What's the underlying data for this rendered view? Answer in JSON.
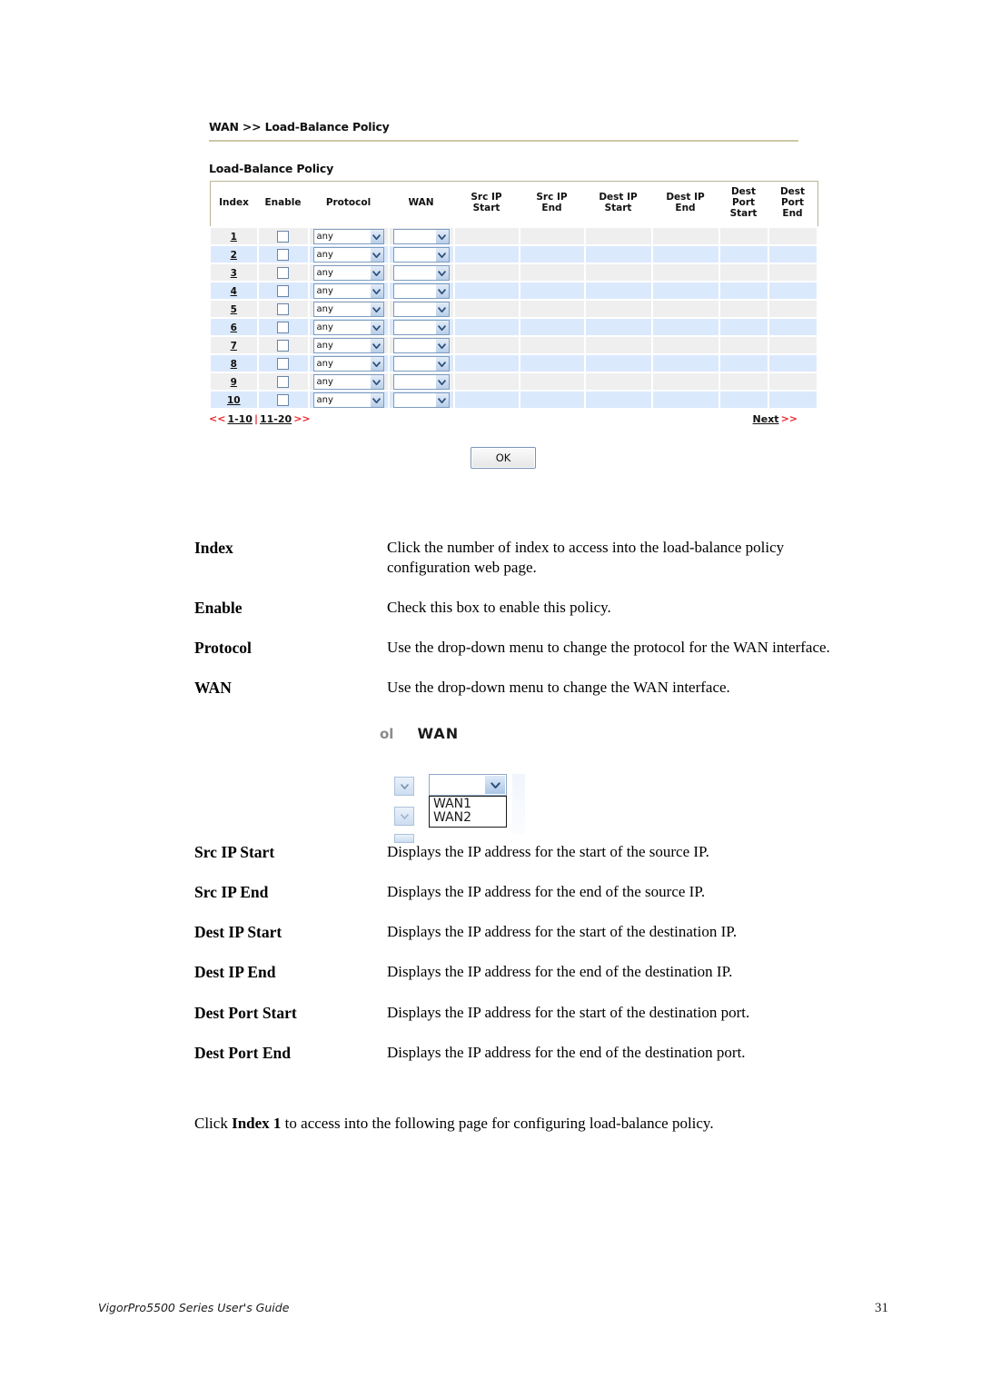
{
  "router_ui": {
    "breadcrumb": "WAN >> Load-Balance Policy",
    "section_title": "Load-Balance Policy",
    "columns": [
      "Index",
      "Enable",
      "Protocol",
      "WAN",
      "Src IP\nStart",
      "Src IP\nEnd",
      "Dest IP\nStart",
      "Dest IP\nEnd",
      "Dest\nPort\nStart",
      "Dest\nPort\nEnd"
    ],
    "column_labels": {
      "index": "Index",
      "enable": "Enable",
      "protocol": "Protocol",
      "wan": "WAN",
      "src_ip_start_l1": "Src IP",
      "src_ip_start_l2": "Start",
      "src_ip_end_l1": "Src IP",
      "src_ip_end_l2": "End",
      "dest_ip_start_l1": "Dest IP",
      "dest_ip_start_l2": "Start",
      "dest_ip_end_l1": "Dest IP",
      "dest_ip_end_l2": "End",
      "dest_port_start_l1": "Dest",
      "dest_port_start_l2": "Port",
      "dest_port_start_l3": "Start",
      "dest_port_end_l1": "Dest",
      "dest_port_end_l2": "Port",
      "dest_port_end_l3": "End"
    },
    "rows": [
      {
        "index": "1",
        "enable": false,
        "protocol": "any",
        "wan": "",
        "src_ip_start": "",
        "src_ip_end": "",
        "dest_ip_start": "",
        "dest_ip_end": "",
        "dest_port_start": "",
        "dest_port_end": ""
      },
      {
        "index": "2",
        "enable": false,
        "protocol": "any",
        "wan": "",
        "src_ip_start": "",
        "src_ip_end": "",
        "dest_ip_start": "",
        "dest_ip_end": "",
        "dest_port_start": "",
        "dest_port_end": ""
      },
      {
        "index": "3",
        "enable": false,
        "protocol": "any",
        "wan": "",
        "src_ip_start": "",
        "src_ip_end": "",
        "dest_ip_start": "",
        "dest_ip_end": "",
        "dest_port_start": "",
        "dest_port_end": ""
      },
      {
        "index": "4",
        "enable": false,
        "protocol": "any",
        "wan": "",
        "src_ip_start": "",
        "src_ip_end": "",
        "dest_ip_start": "",
        "dest_ip_end": "",
        "dest_port_start": "",
        "dest_port_end": ""
      },
      {
        "index": "5",
        "enable": false,
        "protocol": "any",
        "wan": "",
        "src_ip_start": "",
        "src_ip_end": "",
        "dest_ip_start": "",
        "dest_ip_end": "",
        "dest_port_start": "",
        "dest_port_end": ""
      },
      {
        "index": "6",
        "enable": false,
        "protocol": "any",
        "wan": "",
        "src_ip_start": "",
        "src_ip_end": "",
        "dest_ip_start": "",
        "dest_ip_end": "",
        "dest_port_start": "",
        "dest_port_end": ""
      },
      {
        "index": "7",
        "enable": false,
        "protocol": "any",
        "wan": "",
        "src_ip_start": "",
        "src_ip_end": "",
        "dest_ip_start": "",
        "dest_ip_end": "",
        "dest_port_start": "",
        "dest_port_end": ""
      },
      {
        "index": "8",
        "enable": false,
        "protocol": "any",
        "wan": "",
        "src_ip_start": "",
        "src_ip_end": "",
        "dest_ip_start": "",
        "dest_ip_end": "",
        "dest_port_start": "",
        "dest_port_end": ""
      },
      {
        "index": "9",
        "enable": false,
        "protocol": "any",
        "wan": "",
        "src_ip_start": "",
        "src_ip_end": "",
        "dest_ip_start": "",
        "dest_ip_end": "",
        "dest_port_start": "",
        "dest_port_end": ""
      },
      {
        "index": "10",
        "enable": false,
        "protocol": "any",
        "wan": "",
        "src_ip_start": "",
        "src_ip_end": "",
        "dest_ip_start": "",
        "dest_ip_end": "",
        "dest_port_start": "",
        "dest_port_end": ""
      }
    ],
    "pager": {
      "prev_marker": "<<",
      "page_1": "1-10",
      "separator": "|",
      "page_2": "11-20",
      "next_marker": ">>",
      "next_label": "Next",
      "next_arrows": ">>"
    },
    "ok_button": "OK",
    "colors": {
      "row_gray": "#efefef",
      "row_blue": "#dbe9fd",
      "table_border": "#b9b497",
      "divider": "#cdc8a5",
      "pager_red": "#e8262b"
    }
  },
  "definitions": [
    {
      "term": "Index",
      "desc": "Click the number of index to access into the load-balance policy configuration web page."
    },
    {
      "term": "Enable",
      "desc": "Check this box to enable this policy."
    },
    {
      "term": "Protocol",
      "desc": "Use the drop-down menu to change the protocol for the WAN interface."
    },
    {
      "term": "WAN",
      "desc": "Use the drop-down menu to change the WAN interface."
    },
    {
      "term": "Src IP Start",
      "desc": "Displays the IP address for the start of the source IP."
    },
    {
      "term": "Src IP End",
      "desc": "Displays the IP address for the end of the source IP."
    },
    {
      "term": "Dest IP Start",
      "desc": "Displays the IP address for the start of the destination IP."
    },
    {
      "term": "Dest IP End",
      "desc": "Displays the IP address for the end of the destination IP."
    },
    {
      "term": "Dest Port Start",
      "desc": "Displays the IP address for the start of the destination port."
    },
    {
      "term": "Dest Port End",
      "desc": "Displays the IP address for the end of the destination port."
    }
  ],
  "wan_figure": {
    "clipped_label": "ol",
    "header": "WAN",
    "selected_value": "",
    "options": [
      "WAN1",
      "WAN2"
    ]
  },
  "closing": {
    "before": "Click ",
    "bold": "Index 1",
    "after": " to access into the following page for configuring load-balance policy."
  },
  "footer": {
    "guide": "VigorPro5500 Series User's Guide",
    "page_number": "31"
  }
}
